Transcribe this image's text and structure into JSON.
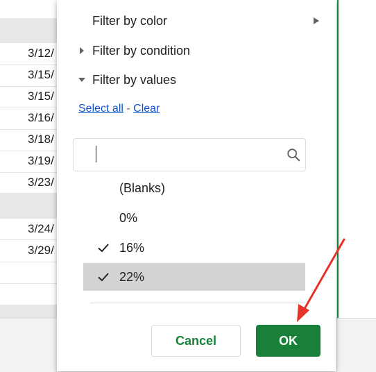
{
  "sheet": {
    "rows": [
      {
        "text": "",
        "gray": true
      },
      {
        "text": "3/12/",
        "gray": false
      },
      {
        "text": "3/15/",
        "gray": false
      },
      {
        "text": "3/15/",
        "gray": false
      },
      {
        "text": "3/16/",
        "gray": false
      },
      {
        "text": "3/18/",
        "gray": false
      },
      {
        "text": "3/19/",
        "gray": false
      },
      {
        "text": "3/23/",
        "gray": false
      },
      {
        "text": "",
        "gray": true
      },
      {
        "text": "3/24/",
        "gray": false
      },
      {
        "text": "3/29/",
        "gray": false
      },
      {
        "text": "",
        "gray": false
      },
      {
        "text": "",
        "gray": false
      },
      {
        "text": "",
        "gray": true
      }
    ]
  },
  "filter_menu": {
    "filter_by_color": "Filter by color",
    "filter_by_condition": "Filter by condition",
    "filter_by_values": "Filter by values",
    "select_all": "Select all",
    "separator": " - ",
    "clear": "Clear",
    "search_value": "",
    "values": [
      {
        "label": "(Blanks)",
        "checked": false,
        "highlighted": false
      },
      {
        "label": "0%",
        "checked": false,
        "highlighted": false
      },
      {
        "label": "16%",
        "checked": true,
        "highlighted": false
      },
      {
        "label": "22%",
        "checked": true,
        "highlighted": true
      }
    ],
    "cancel_label": "Cancel",
    "ok_label": "OK"
  },
  "colors": {
    "accent_green": "#188038",
    "link_blue": "#1155cc",
    "annotation_red": "#e5332a"
  },
  "icons": [
    "chevron-right-icon",
    "triangle-right-icon",
    "triangle-down-icon",
    "search-icon",
    "check-icon",
    "red-arrow-icon"
  ]
}
